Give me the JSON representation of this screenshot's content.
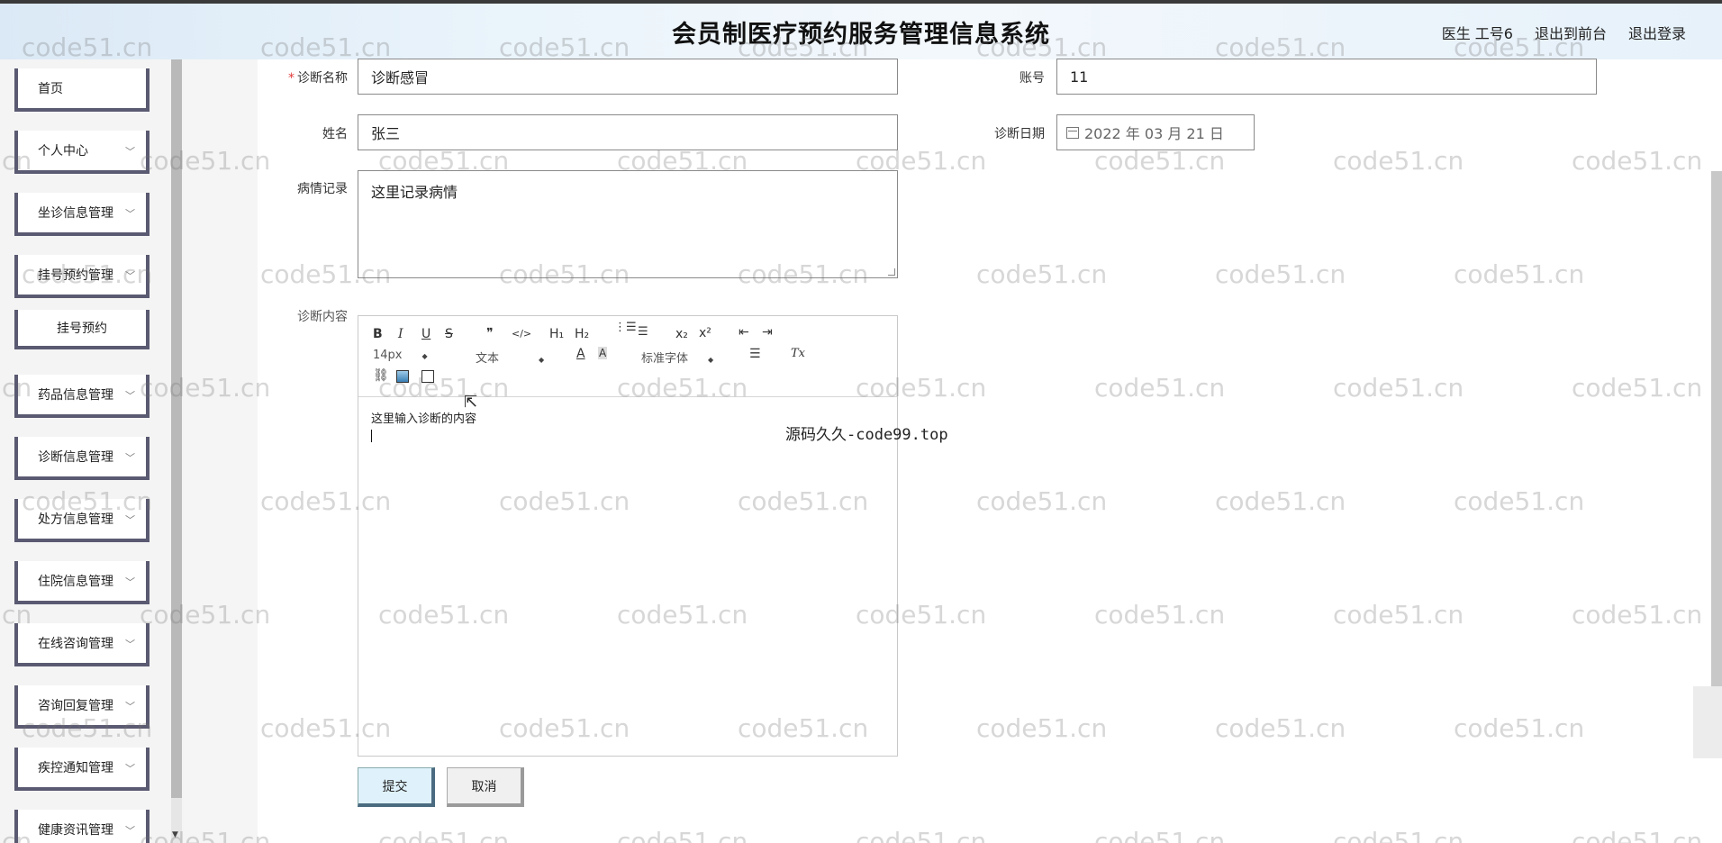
{
  "header": {
    "title": "会员制医疗预约服务管理信息系统",
    "user": "医生 工号6",
    "back_front": "退出到前台",
    "logout": "退出登录"
  },
  "sidebar": {
    "items": [
      {
        "label": "首页",
        "has_chevron": false
      },
      {
        "label": "个人中心",
        "has_chevron": true
      },
      {
        "label": "坐诊信息管理",
        "has_chevron": true
      },
      {
        "label": "挂号预约管理",
        "has_chevron": true
      },
      {
        "label": "挂号预约",
        "has_chevron": false
      },
      {
        "label": "药品信息管理",
        "has_chevron": true
      },
      {
        "label": "诊断信息管理",
        "has_chevron": true
      },
      {
        "label": "处方信息管理",
        "has_chevron": true
      },
      {
        "label": "住院信息管理",
        "has_chevron": true
      },
      {
        "label": "在线咨询管理",
        "has_chevron": true
      },
      {
        "label": "咨询回复管理",
        "has_chevron": true
      },
      {
        "label": "疾控通知管理",
        "has_chevron": true
      },
      {
        "label": "健康资讯管理",
        "has_chevron": true
      }
    ]
  },
  "form": {
    "diag_name_label": "诊断名称",
    "diag_name_required": "*",
    "diag_name_value": "诊断感冒",
    "account_label": "账号",
    "account_value": "11",
    "name_label": "姓名",
    "name_value": "张三",
    "diag_date_label": "诊断日期",
    "diag_date_value": "2022 年 03 月 21 日",
    "record_label": "病情记录",
    "record_value": "这里记录病情",
    "content_label": "诊断内容",
    "content_value": "这里输入诊断的内容"
  },
  "editor": {
    "bold": "B",
    "italic": "I",
    "underline": "U",
    "strike": "S",
    "quote": "❞",
    "code": "</>",
    "h1": "H₁",
    "h2": "H₂",
    "sub": "x₂",
    "sup": "x²",
    "size": "14px",
    "header_sel": "文本",
    "font_sel": "标准字体",
    "color": "A",
    "clear": "Tx"
  },
  "buttons": {
    "submit": "提交",
    "cancel": "取消"
  },
  "watermark": {
    "text": "code51.cn",
    "overlay": "源码久久-code99.top"
  }
}
